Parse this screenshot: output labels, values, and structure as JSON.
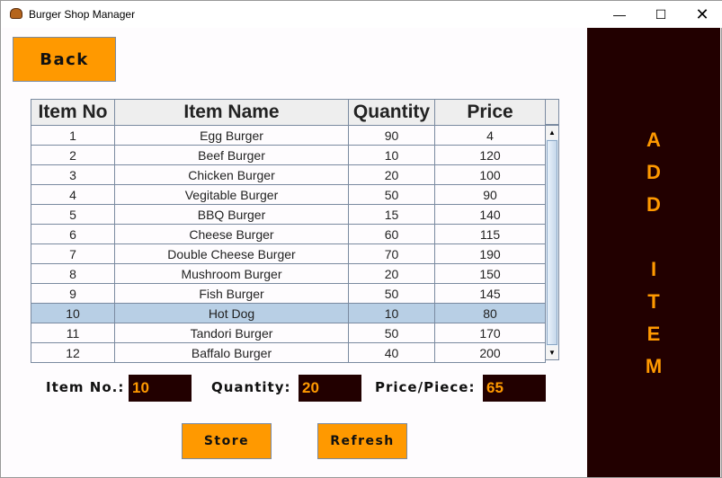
{
  "window": {
    "title": "Burger Shop Manager",
    "controls": [
      "minimize",
      "maximize",
      "close"
    ]
  },
  "back_label": "Back",
  "side_panel": {
    "letters": [
      "A",
      "D",
      "D",
      "I",
      "T",
      "E",
      "M"
    ]
  },
  "table": {
    "columns": [
      "Item No",
      "Item Name",
      "Quantity",
      "Price"
    ],
    "rows": [
      [
        "1",
        "Egg Burger",
        "90",
        "4"
      ],
      [
        "2",
        "Beef Burger",
        "10",
        "120"
      ],
      [
        "3",
        "Chicken Burger",
        "20",
        "100"
      ],
      [
        "4",
        "Vegitable Burger",
        "50",
        "90"
      ],
      [
        "5",
        "BBQ Burger",
        "15",
        "140"
      ],
      [
        "6",
        "Cheese Burger",
        "60",
        "115"
      ],
      [
        "7",
        "Double Cheese Burger",
        "70",
        "190"
      ],
      [
        "8",
        "Mushroom Burger",
        "20",
        "150"
      ],
      [
        "9",
        "Fish Burger",
        "50",
        "145"
      ],
      [
        "10",
        "Hot Dog",
        "10",
        "80"
      ],
      [
        "11",
        "Tandori Burger",
        "50",
        "170"
      ],
      [
        "12",
        "Baffalo Burger",
        "40",
        "200"
      ]
    ],
    "selected_row": 10
  },
  "form": {
    "item_no_label": "Item No.:",
    "item_no_value": "10",
    "quantity_label": "Quantity:",
    "quantity_value": "20",
    "price_label": "Price/Piece:",
    "price_value": "65"
  },
  "store_label": "Store",
  "refresh_label": "Refresh",
  "colors": {
    "accent": "#ff9900",
    "panel": "#220000",
    "selection": "#b8cfe5"
  }
}
